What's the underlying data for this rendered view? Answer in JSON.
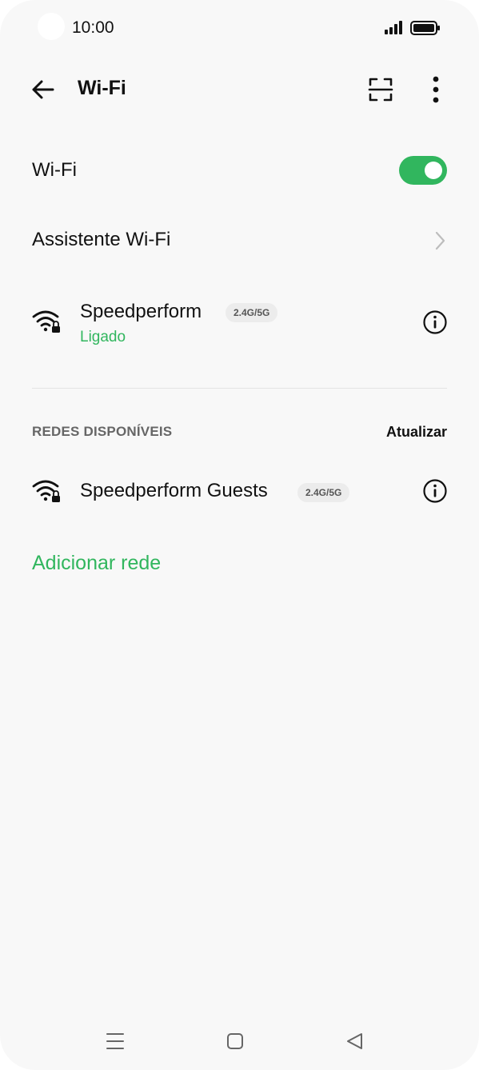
{
  "status_bar": {
    "time": "10:00",
    "icons": [
      "signal-icon",
      "battery-icon"
    ]
  },
  "appbar": {
    "title": "Wi-Fi",
    "icons": [
      "back-arrow-icon",
      "scan-qr-icon",
      "more-vert-icon"
    ]
  },
  "wifi_toggle": {
    "label": "Wi-Fi",
    "state": "on",
    "accent": "#31b65e"
  },
  "assistant": {
    "label": "Assistente Wi-Fi"
  },
  "connected_network": {
    "name": "Speedperform",
    "band": "2.4G/5G",
    "status": "Ligado"
  },
  "available": {
    "section_title": "REDES DISPONÍVEIS",
    "refresh_label": "Atualizar",
    "networks": [
      {
        "name": "Speedperform Guests",
        "band": "2.4G/5G"
      }
    ]
  },
  "add_network": {
    "label": "Adicionar rede"
  },
  "navbar": {
    "icons": [
      "menu-icon",
      "home-icon",
      "back-triangle-icon"
    ]
  }
}
